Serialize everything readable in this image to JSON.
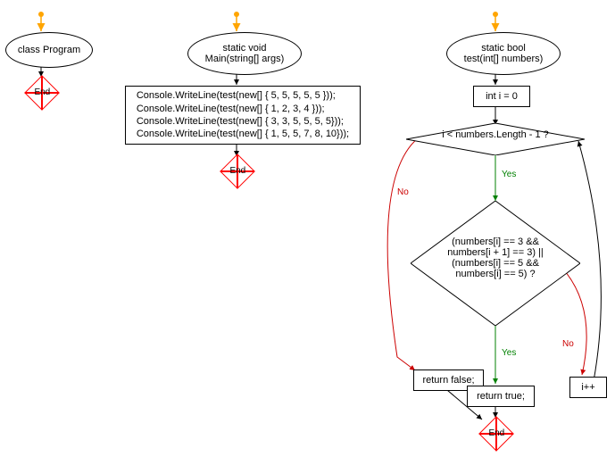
{
  "flow1": {
    "title": "class Program",
    "end": "End"
  },
  "flow2": {
    "title_line1": "static void",
    "title_line2": "Main(string[] args)",
    "code_line1": "Console.WriteLine(test(new[] { 5, 5, 5, 5, 5 }));",
    "code_line2": "Console.WriteLine(test(new[] { 1, 2, 3, 4 }));",
    "code_line3": "Console.WriteLine(test(new[] { 3, 3, 5, 5, 5, 5}));",
    "code_line4": "Console.WriteLine(test(new[] { 1, 5, 5, 7, 8, 10}));",
    "end": "End"
  },
  "flow3": {
    "title_line1": "static bool",
    "title_line2": "test(int[] numbers)",
    "init": "int i = 0",
    "cond1": "i < numbers.Length - 1 ?",
    "cond2_line1": "(numbers[i] == 3 &&",
    "cond2_line2": "numbers[i + 1] == 3) ||",
    "cond2_line3": "(numbers[i] == 5 &&",
    "cond2_line4": "numbers[i] == 5) ?",
    "ret_false": "return false;",
    "ret_true": "return true;",
    "inc": "i++",
    "end": "End",
    "yes": "Yes",
    "no": "No"
  }
}
